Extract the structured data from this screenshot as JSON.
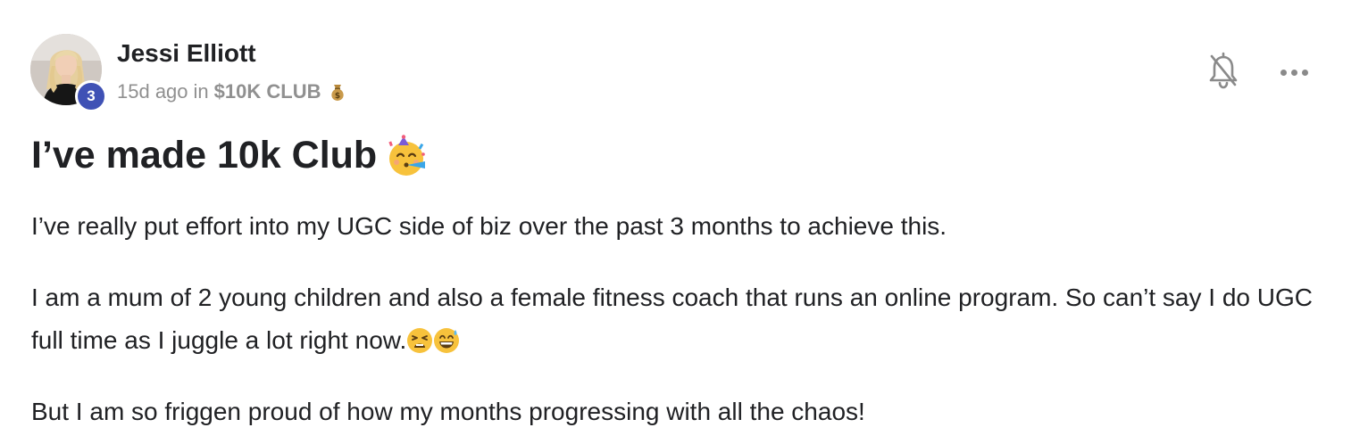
{
  "post": {
    "author": {
      "name": "Jessi Elliott",
      "level": "3",
      "avatar": "avatar-photo"
    },
    "meta": {
      "time": "15d ago",
      "in_word": "in",
      "category": "$10K CLUB",
      "category_icon": "money-bag-emoji"
    },
    "actions": {
      "notify_icon": "bell-off-icon",
      "more_icon": "more-horizontal-icon"
    },
    "title": "I’ve made 10k Club",
    "title_icon": "partying-face-emoji",
    "paragraphs": {
      "p1": "I’ve really put effort into my UGC side of biz over the past 3 months to achieve this.",
      "p2": "I am a mum of 2 young children and also a female fitness coach that runs an online program. So can’t say I do UGC full time as I juggle a lot right now.",
      "p2_icons": [
        "tired-face-emoji",
        "grinning-sweat-emoji"
      ],
      "p3": "But I am so friggen proud of how my months progressing with all the chaos!"
    },
    "colors": {
      "level_badge": "#3f51b5",
      "meta_text": "#909090",
      "text": "#202124"
    }
  }
}
